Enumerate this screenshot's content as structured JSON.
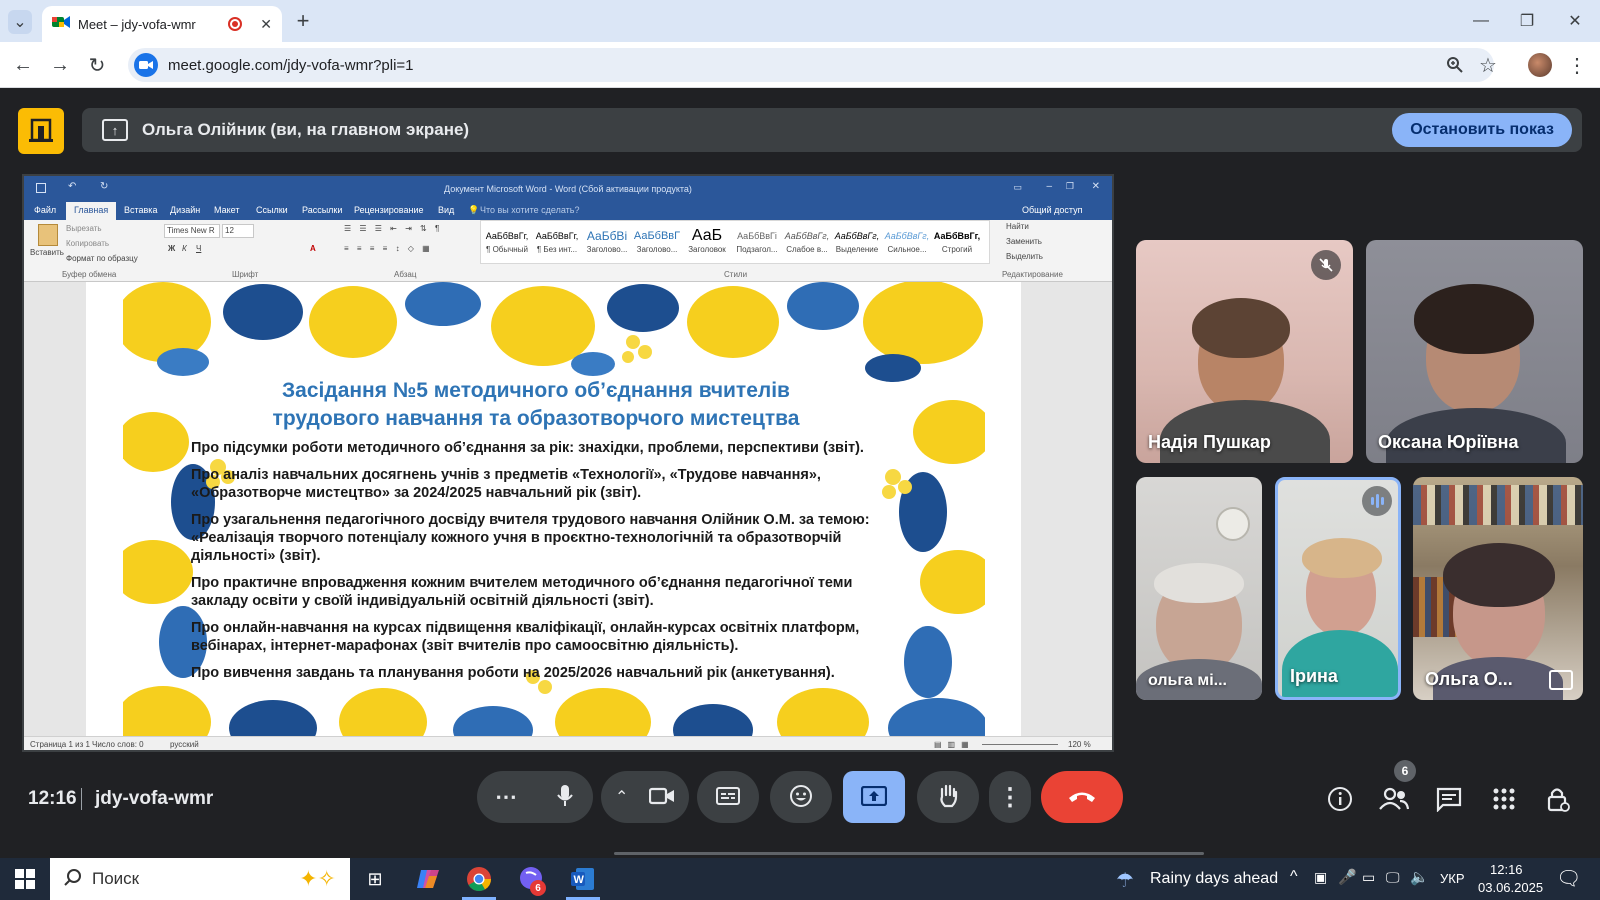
{
  "browser": {
    "tab_title": "Meet – jdy-vofa-wmr",
    "url": "meet.google.com/jdy-vofa-wmr?pli=1"
  },
  "meet": {
    "presenter_banner": "Ольга Олійник (ви, на главном экране)",
    "stop_sharing": "Остановить показ",
    "time": "12:16",
    "meeting_code": "jdy-vofa-wmr",
    "participants_count": "6",
    "participants": [
      {
        "name": "Надія Пушкар",
        "muted": true
      },
      {
        "name": "Оксана Юріївна",
        "muted": false
      },
      {
        "name": "ольга мі...",
        "muted": false
      },
      {
        "name": "Ірина",
        "speaking": true
      },
      {
        "name": "Ольга О...",
        "muted": false
      }
    ]
  },
  "word": {
    "title": "Документ Microsoft Word - Word (Сбой активации продукта)",
    "tabs": [
      "Файл",
      "Главная",
      "Вставка",
      "Дизайн",
      "Макет",
      "Ссылки",
      "Рассылки",
      "Рецензирование",
      "Вид"
    ],
    "tell_me": "Что вы хотите сделать?",
    "share": "Общий доступ",
    "clipboard": {
      "paste": "Вставить",
      "cut": "Вырезать",
      "copy": "Копировать",
      "format_painter": "Формат по образцу",
      "group": "Буфер обмена"
    },
    "font": {
      "name": "Times New R",
      "size": "12",
      "group": "Шрифт"
    },
    "paragraph_group": "Абзац",
    "styles_group": "Стили",
    "editing": {
      "find": "Найти",
      "replace": "Заменить",
      "select": "Выделить",
      "group": "Редактирование"
    },
    "styles": [
      {
        "sample": "АаБбВвГг,",
        "name": "¶ Обычный"
      },
      {
        "sample": "АаБбВвГг,",
        "name": "¶ Без инт..."
      },
      {
        "sample": "АаБбВі",
        "name": "Заголово..."
      },
      {
        "sample": "АаБбВвГ",
        "name": "Заголово..."
      },
      {
        "sample": "АаБ",
        "name": "Заголовок"
      },
      {
        "sample": "АаБбВвГі",
        "name": "Подзагол..."
      },
      {
        "sample": "АаБбВвГг,",
        "name": "Слабое в..."
      },
      {
        "sample": "АаБбВвГг,",
        "name": "Выделение"
      },
      {
        "sample": "АаБбВвГг,",
        "name": "Сильное..."
      },
      {
        "sample": "АаБбВвГг,",
        "name": "Строгий"
      }
    ],
    "status_page": "Страница 1 из 1",
    "status_words": "Число слов: 0",
    "status_lang": "русский",
    "zoom": "120 %"
  },
  "slide": {
    "title_line1": "Засідання №5 методичного об’єднання вчителів",
    "title_line2": "трудового навчання та образотворчого мистецтва",
    "items": [
      "Про підсумки роботи методичного об’єднання за рік: знахідки, проблеми, перспективи (звіт).",
      "Про аналіз навчальних досягнень учнів з предметів «Технології», «Трудове навчання», «Образотворче мистецтво» за 2024/2025 навчальний рік (звіт).",
      "Про узагальнення педагогічного досвіду вчителя трудового навчання Олійник О.М. за темою: «Реалізація творчого потенціалу кожного учня в проєктно-технологічній та образотворчій діяльності» (звіт).",
      "Про практичне впровадження кожним вчителем методичного об’єднання педагогічної теми закладу освіти у своїй індивідуальній освітній діяльності (звіт).",
      " Про онлайн-навчання на курсах підвищення кваліфікації, онлайн-курсах освітніх платформ, вебінарах, інтернет-марафонах (звіт вчителів про самоосвітню діяльність).",
      "Про вивчення завдань та планування роботи на 2025/2026 навчальний рік (анкетування)."
    ]
  },
  "taskbar": {
    "search": "Поиск",
    "weather": "Rainy days ahead",
    "lang": "УКР",
    "clock_time": "12:16",
    "clock_date": "03.06.2025",
    "viber_badge": "6"
  }
}
